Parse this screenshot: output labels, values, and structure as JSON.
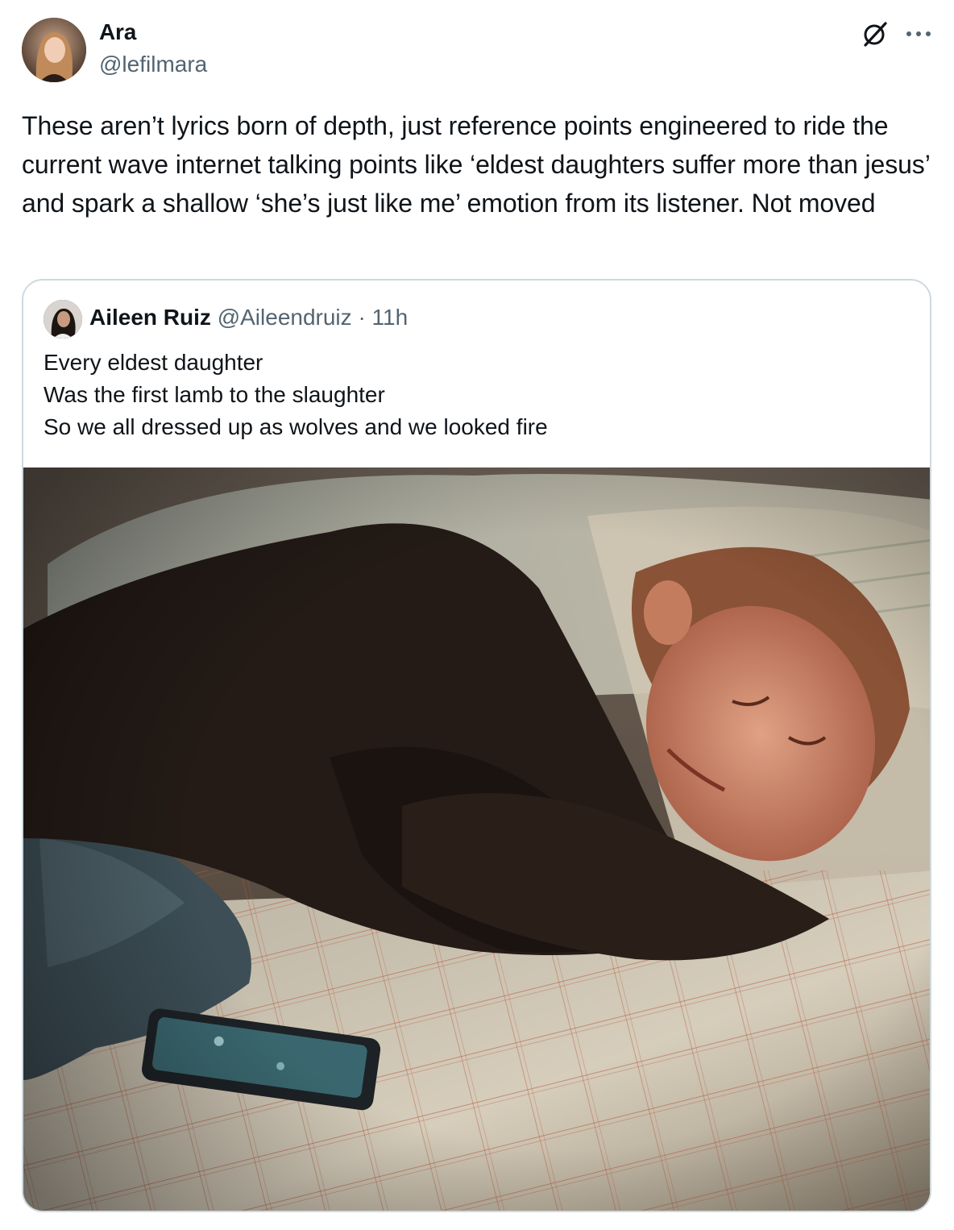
{
  "tweet": {
    "author_name": "Ara",
    "author_handle": "@lefilmara",
    "text": "These aren’t lyrics born of depth, just reference points engineered to ride the current wave internet talking points like ‘eldest daughters suffer more than jesus’ and spark a shallow ‘she’s just like me’ emotion from its listener. Not moved",
    "icons": [
      "grok-icon",
      "more-icon"
    ]
  },
  "quote": {
    "author_name": "Aileen Ruiz",
    "author_handle": "@Aileendruiz",
    "separator": "·",
    "time": "11h",
    "text": "Every eldest daughter\nWas the first lamb to the slaughter\nSo we all dressed up as wolves and we looked fire"
  }
}
